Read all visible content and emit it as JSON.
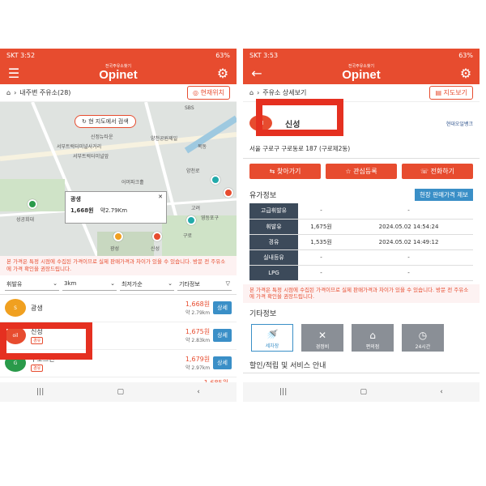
{
  "left": {
    "status": {
      "carrier_time": "SKT 3:52",
      "right": "63%"
    },
    "app": {
      "logo_sub": "전국주유소찾기",
      "logo_main": "Opinet"
    },
    "subhead": {
      "title": "내주변 주유소(28)",
      "button": "현재위치"
    },
    "map": {
      "search_button": "현 지도에서 검색",
      "labels": [
        "SBS",
        "신정뉴타운",
        "양천공원제일",
        "서부트럭터미널사거리",
        "서부트럭터미널앞",
        "목동",
        "양천로",
        "어머파크홀",
        "고려",
        "영등포구",
        "성공회대",
        "광성",
        "신성",
        "구로"
      ],
      "popup": {
        "name": "광생",
        "price": "1,668원",
        "distance": "약2.79Km",
        "close": "✕"
      }
    },
    "notice": "본 가격은 특정 시점에 수집된 가격이므로 실제 판매가격과 차이가 있을 수 있습니다. 방문 전 주유소에 가격 확인을 권장드립니다.",
    "filters": {
      "fuel": "휘발유",
      "radius": "3km",
      "sort": "최저가순",
      "other": "기타정보"
    },
    "stations": [
      {
        "name": "광생",
        "price": "1,668원",
        "distance": "약 2.79km",
        "detail": "상세",
        "badge": "",
        "logo_color": "#f0a020"
      },
      {
        "name": "신성",
        "price": "1,675원",
        "distance": "약 2.83km",
        "detail": "상세",
        "badge": "경유",
        "logo_color": "#e74c2f"
      },
      {
        "name": "구로그린",
        "price": "1,679원",
        "distance": "약 2.97km",
        "detail": "상세",
        "badge": "경유",
        "logo_color": "#2a9a4a"
      },
      {
        "name": "",
        "price": "1,685원",
        "distance": "",
        "detail": "",
        "badge": "",
        "logo_color": "#e74c2f"
      }
    ],
    "nav": [
      "|||",
      "▢",
      "‹"
    ]
  },
  "right": {
    "status": {
      "carrier_time": "SKT 3:53",
      "right": "63%"
    },
    "app": {
      "logo_sub": "전국주유소찾기",
      "logo_main": "Opinet"
    },
    "subhead": {
      "title": "주유소 상세보기",
      "button": "지도보기"
    },
    "station": {
      "name": "신성",
      "address": "서울 구로구 구로동로 187 (구로제2동)",
      "brand": "현대오일뱅크"
    },
    "actions": {
      "navigate": "찾아가기",
      "favorite": "관심등록",
      "call": "전화하기"
    },
    "price_title": "유가정보",
    "report_button": "현장 판매가격 제보",
    "prices": [
      {
        "label": "고급휘발유",
        "price": "-",
        "time": "-"
      },
      {
        "label": "휘발유",
        "price": "1,675원",
        "time": "2024.05.02 14:54:24"
      },
      {
        "label": "경유",
        "price": "1,535원",
        "time": "2024.05.02 14:49:12"
      },
      {
        "label": "실내등유",
        "price": "-",
        "time": "-"
      },
      {
        "label": "LPG",
        "price": "-",
        "time": "-"
      }
    ],
    "notice": "본 가격은 특정 시점에 수집된 가격이므로 실제 판매가격과 차이가 있을 수 있습니다. 방문 전 주유소에 가격 확인을 권장드립니다.",
    "etc_title": "기타정보",
    "features": [
      {
        "label": "세차장",
        "active": true
      },
      {
        "label": "경정비",
        "active": false
      },
      {
        "label": "편의점",
        "active": false
      },
      {
        "label": "24시간",
        "active": false
      }
    ],
    "discount_title": "할인/적립 및 서비스 안내",
    "nav": [
      "|||",
      "▢",
      "‹"
    ]
  },
  "colors": {
    "accent": "#e74c2f",
    "blue": "#3a8fc7",
    "highlight": "#e53020"
  }
}
